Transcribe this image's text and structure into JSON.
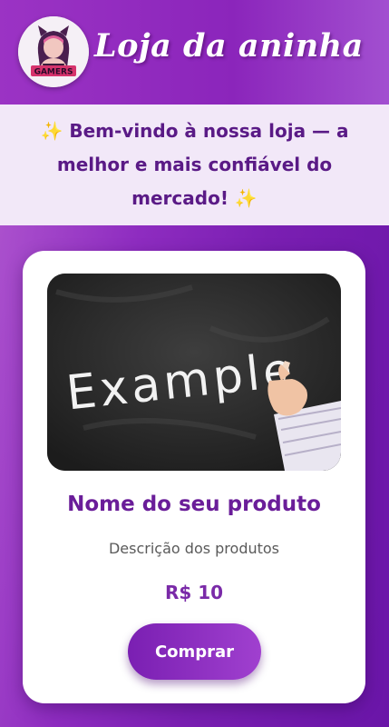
{
  "header": {
    "title": "Loja da aninha",
    "logo_text": "GAMERS",
    "logo_icon": "gamer-girl-logo"
  },
  "welcome": {
    "message": "✨ Bem-vindo à nossa loja — a melhor e mais confiável do mercado! ✨"
  },
  "product": {
    "image_text": "Example",
    "image_icon": "chalkboard-example-image",
    "name": "Nome do seu produto",
    "description": "Descrição dos produtos",
    "price": "R$ 10",
    "buy_label": "Comprar"
  },
  "colors": {
    "primary": "#8b25bb",
    "primary_dark": "#6a1d99",
    "welcome_bg": "#f2e8f8",
    "welcome_text": "#5a1a86"
  }
}
